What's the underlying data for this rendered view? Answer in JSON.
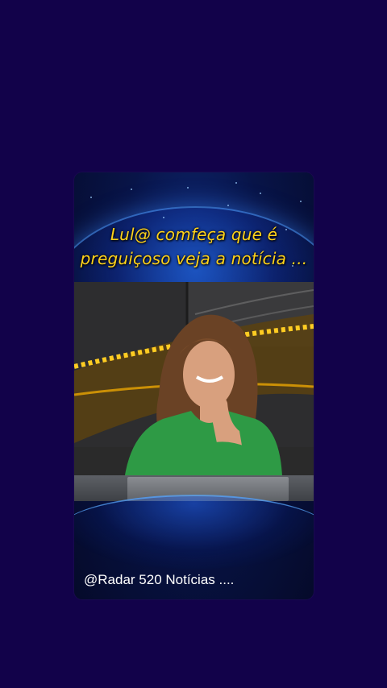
{
  "post": {
    "headline_line1": "Lul@ comfeça que é",
    "headline_line2": "preguiçoso veja a notícia ...",
    "caption": "@Radar 520 Notícias ...."
  },
  "colors": {
    "page_background": "#12024a",
    "headline_color": "#ffd21a",
    "globe_glow": "#3c8cff"
  }
}
